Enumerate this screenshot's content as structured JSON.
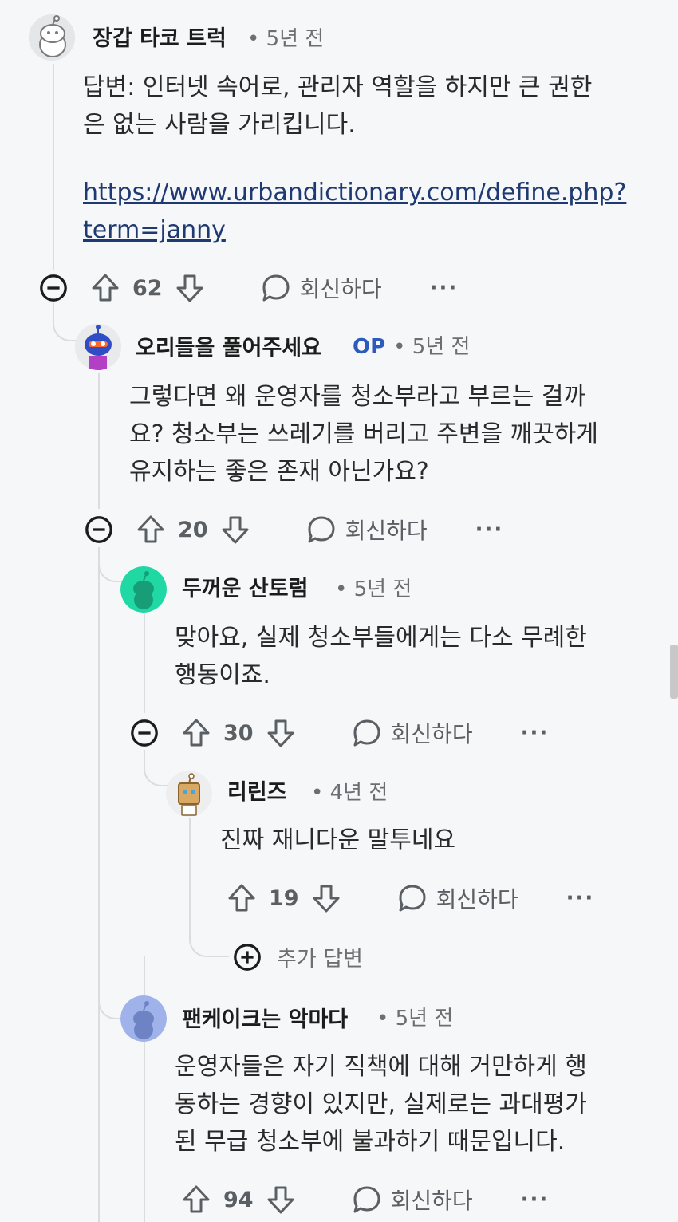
{
  "comments": [
    {
      "username": "장갑 타코 트럭",
      "op": "",
      "time": "5년 전",
      "body_lines": [
        "답변: 인터넷 속어로, 관리자 역할을 하지만 큰 권한",
        "은 없는 사람을 가리킵니다."
      ],
      "link_lines": [
        "https://www.urbandictionary.com/define.php?",
        "term=janny"
      ],
      "votes": "62",
      "reply_label": "회신하다",
      "more": "···"
    },
    {
      "username": "오리들을 풀어주세요",
      "op": "OP",
      "time": "5년 전",
      "body_lines": [
        "그렇다면 왜 운영자를 청소부라고 부르는 걸까",
        "요? 청소부는 쓰레기를 버리고 주변을 깨끗하게",
        "유지하는 좋은 존재 아닌가요?"
      ],
      "votes": "20",
      "reply_label": "회신하다",
      "more": "···"
    },
    {
      "username": "두꺼운 산토럼",
      "op": "",
      "time": "5년 전",
      "body_lines": [
        "맞아요, 실제 청소부들에게는 다소 무례한",
        "행동이죠."
      ],
      "votes": "30",
      "reply_label": "회신하다",
      "more": "···"
    },
    {
      "username": "리린즈",
      "op": "",
      "time": "4년 전",
      "body_lines": [
        "진짜 재니다운 말투네요"
      ],
      "votes": "19",
      "reply_label": "회신하다",
      "more": "···"
    },
    {
      "username": "팬케이크는 악마다",
      "op": "",
      "time": "5년 전",
      "body_lines": [
        "운영자들은 자기 직책에 대해 거만하게 행",
        "동하는 경향이 있지만, 실제로는 과대평가",
        "된 무급 청소부에 불과하기 때문입니다."
      ],
      "votes": "94",
      "reply_label": "회신하다",
      "more": "···"
    }
  ],
  "more_replies": {
    "label": "추가 답변"
  },
  "colors": {
    "op": "#2d5bbd",
    "thread": "#dadce0",
    "background": "#f6f7f8"
  },
  "icons": [
    "collapse-icon",
    "upvote-icon",
    "downvote-icon",
    "comment-bubble-icon",
    "more-icon",
    "plus-circle-icon"
  ]
}
